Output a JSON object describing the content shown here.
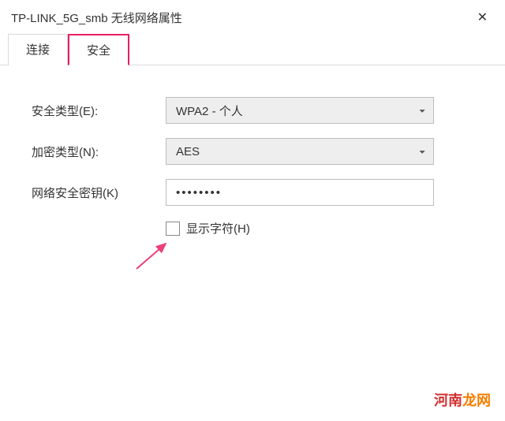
{
  "window": {
    "title": "TP-LINK_5G_smb 无线网络属性"
  },
  "tabs": {
    "connection": "连接",
    "security": "安全"
  },
  "form": {
    "security_type_label": "安全类型(E):",
    "security_type_value": "WPA2 - 个人",
    "encryption_type_label": "加密类型(N):",
    "encryption_type_value": "AES",
    "network_key_label": "网络安全密钥(K)",
    "network_key_value": "••••••••",
    "show_chars_label": "显示字符(H)"
  },
  "watermark": {
    "part1": "河南",
    "part2": "龙网"
  }
}
